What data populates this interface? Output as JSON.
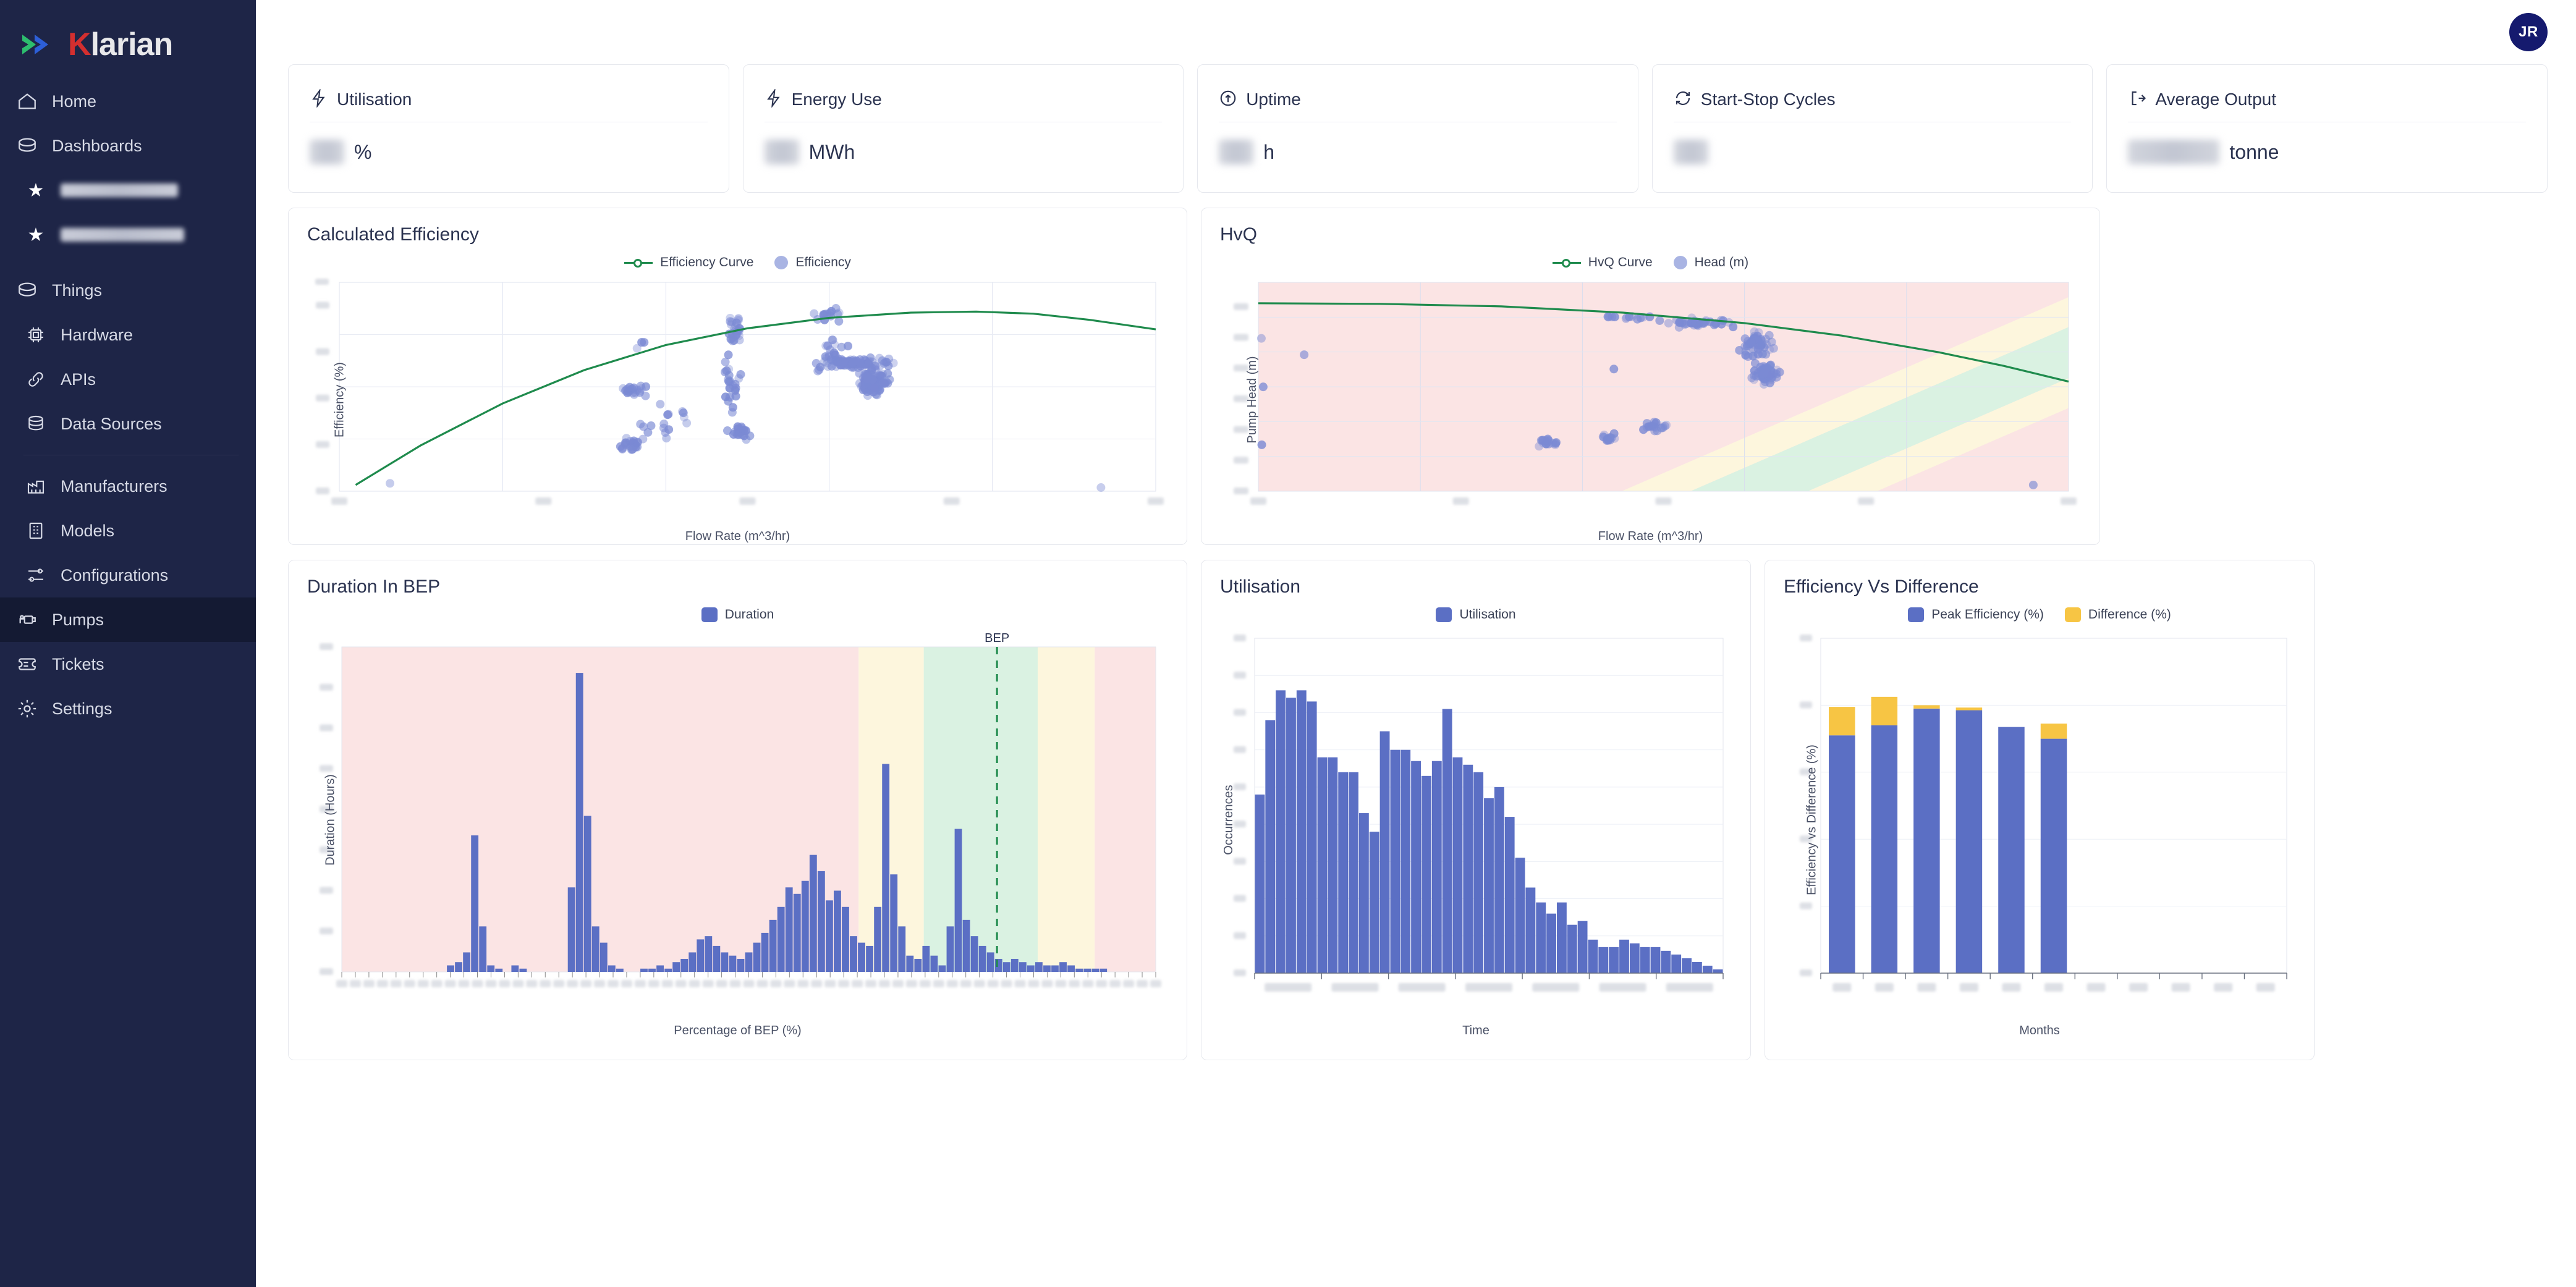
{
  "brand": {
    "name": "Klarian",
    "name_prefix": "K",
    "name_rest": "larian"
  },
  "user": {
    "initials": "JR"
  },
  "sidebar": {
    "items": [
      {
        "label": "Home",
        "icon": "home-icon",
        "level": 0,
        "active": false
      },
      {
        "label": "Dashboards",
        "icon": "dashboard-icon",
        "level": 0,
        "active": false
      },
      {
        "label": "",
        "icon": "star-icon",
        "level": 1,
        "active": false,
        "redacted": true,
        "redacted_width": 190
      },
      {
        "label": "",
        "icon": "star-icon",
        "level": 1,
        "active": false,
        "redacted": true,
        "redacted_width": 200
      },
      {
        "label": "Things",
        "icon": "things-icon",
        "level": 0,
        "active": false
      },
      {
        "label": "Hardware",
        "icon": "chip-icon",
        "level": 1,
        "active": false
      },
      {
        "label": "APIs",
        "icon": "link-icon",
        "level": 1,
        "active": false
      },
      {
        "label": "Data Sources",
        "icon": "database-icon",
        "level": 1,
        "active": false
      },
      {
        "divider": true
      },
      {
        "label": "Manufacturers",
        "icon": "factory-icon",
        "level": 1,
        "active": false
      },
      {
        "label": "Models",
        "icon": "building-icon",
        "level": 1,
        "active": false
      },
      {
        "label": "Configurations",
        "icon": "sliders-icon",
        "level": 1,
        "active": false
      },
      {
        "label": "Pumps",
        "icon": "pump-icon",
        "level": 0,
        "active": true
      },
      {
        "label": "Tickets",
        "icon": "ticket-icon",
        "level": 0,
        "active": false
      },
      {
        "label": "Settings",
        "icon": "gear-icon",
        "level": 0,
        "active": false
      }
    ]
  },
  "kpis": [
    {
      "title": "Utilisation",
      "icon": "bolt-icon",
      "value": "",
      "value_redacted": true,
      "unit": "%",
      "wide": false
    },
    {
      "title": "Energy Use",
      "icon": "bolt-icon",
      "value": "",
      "value_redacted": true,
      "unit": "MWh",
      "wide": false
    },
    {
      "title": "Uptime",
      "icon": "clock-up-icon",
      "value": "",
      "value_redacted": true,
      "unit": "h",
      "wide": false
    },
    {
      "title": "Start-Stop Cycles",
      "icon": "refresh-icon",
      "value": "",
      "value_redacted": true,
      "unit": "",
      "wide": false
    },
    {
      "title": "Average Output",
      "icon": "export-icon",
      "value": "",
      "value_redacted": true,
      "unit": "tonne",
      "wide": true
    }
  ],
  "colors": {
    "accent_blue": "#5b6fc4",
    "scatter_blue": "#7b8ad4",
    "curve_green": "#1f8b4d",
    "difference_yellow": "#f7c544",
    "band_red": "#fbe4e4",
    "band_yellow": "#fdf6dd",
    "band_green": "#daf2e2",
    "sidebar_bg": "#1e2547",
    "sidebar_active": "#141a33",
    "avatar_bg": "#151a6e"
  },
  "chart_data": [
    {
      "id": "calculated-efficiency",
      "type": "scatter",
      "title": "Calculated Efficiency",
      "xlabel": "Flow Rate (m^3/hr)",
      "ylabel": "Efficiency (%)",
      "grid": true,
      "legend_position": "top-center",
      "legend": [
        {
          "name": "Efficiency Curve",
          "marker": "line-circle",
          "color": "#1f8b4d"
        },
        {
          "name": "Efficiency",
          "marker": "circle",
          "color": "#a9b4e3"
        }
      ],
      "axis_ticks_redacted": true,
      "xticks": [
        "",
        "",
        "",
        "",
        "",
        ""
      ],
      "yticks": [
        "",
        "",
        "",
        "",
        ""
      ],
      "series": [
        {
          "name": "Efficiency Curve",
          "type": "line",
          "color": "#1f8b4d",
          "points": [
            [
              0.02,
              0.03
            ],
            [
              0.1,
              0.22
            ],
            [
              0.2,
              0.42
            ],
            [
              0.3,
              0.58
            ],
            [
              0.4,
              0.7
            ],
            [
              0.5,
              0.78
            ],
            [
              0.6,
              0.83
            ],
            [
              0.7,
              0.855
            ],
            [
              0.78,
              0.86
            ],
            [
              0.85,
              0.85
            ],
            [
              0.92,
              0.82
            ],
            [
              1.0,
              0.775
            ]
          ]
        },
        {
          "name": "Efficiency",
          "type": "scatter",
          "color": "#7b8ad4",
          "clusters": [
            {
              "cx": 0.06,
              "cy": 0.04,
              "n": 1,
              "sx": 0.004,
              "sy": 0.004
            },
            {
              "cx": 0.37,
              "cy": 0.71,
              "n": 4,
              "sx": 0.012,
              "sy": 0.02
            },
            {
              "cx": 0.36,
              "cy": 0.48,
              "n": 22,
              "sx": 0.018,
              "sy": 0.035
            },
            {
              "cx": 0.36,
              "cy": 0.22,
              "n": 24,
              "sx": 0.016,
              "sy": 0.028
            },
            {
              "cx": 0.4,
              "cy": 0.33,
              "n": 16,
              "sx": 0.035,
              "sy": 0.1
            },
            {
              "cx": 0.485,
              "cy": 0.78,
              "n": 26,
              "sx": 0.008,
              "sy": 0.065
            },
            {
              "cx": 0.48,
              "cy": 0.5,
              "n": 26,
              "sx": 0.012,
              "sy": 0.16
            },
            {
              "cx": 0.49,
              "cy": 0.28,
              "n": 26,
              "sx": 0.013,
              "sy": 0.035
            },
            {
              "cx": 0.6,
              "cy": 0.85,
              "n": 14,
              "sx": 0.022,
              "sy": 0.05
            },
            {
              "cx": 0.6,
              "cy": 0.67,
              "n": 18,
              "sx": 0.02,
              "sy": 0.08
            },
            {
              "cx": 0.63,
              "cy": 0.615,
              "n": 80,
              "sx": 0.045,
              "sy": 0.022
            },
            {
              "cx": 0.655,
              "cy": 0.52,
              "n": 120,
              "sx": 0.016,
              "sy": 0.055
            },
            {
              "cx": 0.93,
              "cy": 0.02,
              "n": 1,
              "sx": 0.004,
              "sy": 0.004
            }
          ]
        }
      ]
    },
    {
      "id": "hvq",
      "type": "scatter",
      "title": "HvQ",
      "xlabel": "Flow Rate (m^3/hr)",
      "ylabel": "Pump Head (m)",
      "grid": true,
      "legend_position": "top-center",
      "legend": [
        {
          "name": "HvQ Curve",
          "marker": "line-circle",
          "color": "#1f8b4d"
        },
        {
          "name": "Head (m)",
          "marker": "circle",
          "color": "#a9b4e3"
        }
      ],
      "axis_ticks_redacted": true,
      "bep_bands": [
        {
          "color": "#fbe4e4",
          "label": "out-of-range"
        },
        {
          "color": "#fdf6dd",
          "label": "marginal"
        },
        {
          "color": "#daf2e2",
          "label": "optimal"
        }
      ],
      "series": [
        {
          "name": "HvQ Curve",
          "type": "line",
          "color": "#1f8b4d",
          "points": [
            [
              0.0,
              0.9
            ],
            [
              0.15,
              0.897
            ],
            [
              0.3,
              0.885
            ],
            [
              0.45,
              0.855
            ],
            [
              0.6,
              0.805
            ],
            [
              0.72,
              0.745
            ],
            [
              0.84,
              0.665
            ],
            [
              0.92,
              0.6
            ],
            [
              1.0,
              0.525
            ]
          ]
        },
        {
          "name": "Head (m)",
          "type": "scatter",
          "color": "#7b8ad4",
          "clusters": [
            {
              "cx": 0.005,
              "cy": 0.73,
              "n": 1,
              "sx": 0.004,
              "sy": 0.004
            },
            {
              "cx": 0.005,
              "cy": 0.5,
              "n": 1,
              "sx": 0.004,
              "sy": 0.004
            },
            {
              "cx": 0.055,
              "cy": 0.655,
              "n": 1,
              "sx": 0.004,
              "sy": 0.004
            },
            {
              "cx": 0.44,
              "cy": 0.585,
              "n": 1,
              "sx": 0.004,
              "sy": 0.004
            },
            {
              "cx": 0.005,
              "cy": 0.22,
              "n": 1,
              "sx": 0.004,
              "sy": 0.004
            },
            {
              "cx": 0.355,
              "cy": 0.235,
              "n": 18,
              "sx": 0.016,
              "sy": 0.02
            },
            {
              "cx": 0.43,
              "cy": 0.26,
              "n": 14,
              "sx": 0.012,
              "sy": 0.02
            },
            {
              "cx": 0.49,
              "cy": 0.305,
              "n": 18,
              "sx": 0.016,
              "sy": 0.025
            },
            {
              "cx": 0.455,
              "cy": 0.835,
              "n": 14,
              "sx": 0.035,
              "sy": 0.012
            },
            {
              "cx": 0.545,
              "cy": 0.805,
              "n": 40,
              "sx": 0.04,
              "sy": 0.02
            },
            {
              "cx": 0.615,
              "cy": 0.7,
              "n": 55,
              "sx": 0.016,
              "sy": 0.06
            },
            {
              "cx": 0.625,
              "cy": 0.565,
              "n": 60,
              "sx": 0.015,
              "sy": 0.05
            },
            {
              "cx": 0.96,
              "cy": 0.03,
              "n": 1,
              "sx": 0.004,
              "sy": 0.004
            }
          ]
        }
      ]
    },
    {
      "id": "duration-in-bep",
      "type": "bar",
      "title": "Duration In BEP",
      "xlabel": "Percentage of BEP (%)",
      "ylabel": "Duration (Hours)",
      "grid": false,
      "legend_position": "top-center",
      "legend": [
        {
          "name": "Duration",
          "marker": "square",
          "color": "#5b6fc4"
        }
      ],
      "axis_ticks_redacted": true,
      "annotations": [
        {
          "text": "BEP",
          "x_fraction": 0.805,
          "type": "vline",
          "color": "#1f8b4d",
          "dashed": true
        }
      ],
      "bands": [
        {
          "from": 0.0,
          "to": 0.635,
          "color": "#fbe4e4"
        },
        {
          "from": 0.635,
          "to": 0.715,
          "color": "#fdf6dd"
        },
        {
          "from": 0.715,
          "to": 0.855,
          "color": "#daf2e2"
        },
        {
          "from": 0.855,
          "to": 0.925,
          "color": "#fdf6dd"
        },
        {
          "from": 0.925,
          "to": 1.0,
          "color": "#fbe4e4"
        }
      ],
      "values": [
        0,
        0,
        0,
        0,
        0,
        0,
        0,
        0,
        0,
        0,
        0,
        0,
        0,
        2,
        3,
        6,
        42,
        14,
        2,
        1,
        0,
        2,
        1,
        0,
        0,
        0,
        0,
        0,
        26,
        92,
        48,
        14,
        9,
        2,
        1,
        0,
        0,
        1,
        1,
        2,
        1,
        3,
        4,
        6,
        10,
        11,
        8,
        6,
        5,
        4,
        6,
        9,
        12,
        16,
        20,
        26,
        24,
        28,
        36,
        31,
        22,
        25,
        20,
        11,
        9,
        8,
        20,
        64,
        30,
        14,
        5,
        4,
        8,
        5,
        2,
        14,
        44,
        16,
        11,
        8,
        6,
        4,
        3,
        4,
        3,
        2,
        3,
        2,
        2,
        3,
        2,
        1,
        1,
        1,
        1,
        0,
        0,
        0,
        0,
        0,
        0
      ],
      "ylim": [
        0,
        100
      ]
    },
    {
      "id": "utilisation",
      "type": "bar",
      "title": "Utilisation",
      "xlabel": "Time",
      "ylabel": "Occurrences",
      "grid": true,
      "legend_position": "top-center",
      "legend": [
        {
          "name": "Utilisation",
          "marker": "square",
          "color": "#5b6fc4"
        }
      ],
      "axis_ticks_redacted": true,
      "values": [
        48,
        68,
        76,
        74,
        76,
        73,
        58,
        58,
        54,
        54,
        43,
        38,
        65,
        60,
        60,
        57,
        53,
        57,
        71,
        58,
        56,
        54,
        47,
        50,
        42,
        31,
        23,
        19,
        16,
        19,
        13,
        14,
        9,
        7,
        7,
        9,
        8,
        7,
        7,
        6,
        5,
        4,
        3,
        2,
        1
      ],
      "ylim": [
        0,
        90
      ]
    },
    {
      "id": "efficiency-vs-difference",
      "type": "bar",
      "title": "Efficiency Vs Difference",
      "xlabel": "Months",
      "ylabel": "Efficiency vs Difference (%)",
      "grid": true,
      "stacked": true,
      "legend_position": "top-center",
      "legend": [
        {
          "name": "Peak Efficiency (%)",
          "marker": "square",
          "color": "#5b6fc4"
        },
        {
          "name": "Difference (%)",
          "marker": "square",
          "color": "#f7c544"
        }
      ],
      "axis_ticks_redacted": true,
      "categories": [
        "",
        "",
        "",
        "",
        "",
        "",
        "",
        "",
        "",
        "",
        ""
      ],
      "series": [
        {
          "name": "Peak Efficiency (%)",
          "color": "#5b6fc4",
          "values": [
            71,
            74,
            79,
            78.5,
            73.5,
            70,
            0,
            0,
            0,
            0,
            0
          ]
        },
        {
          "name": "Difference (%)",
          "color": "#f7c544",
          "values": [
            8.5,
            8.5,
            1.0,
            0.8,
            0,
            4.5,
            0,
            0,
            0,
            0,
            0
          ]
        }
      ],
      "ylim": [
        0,
        100
      ]
    }
  ]
}
